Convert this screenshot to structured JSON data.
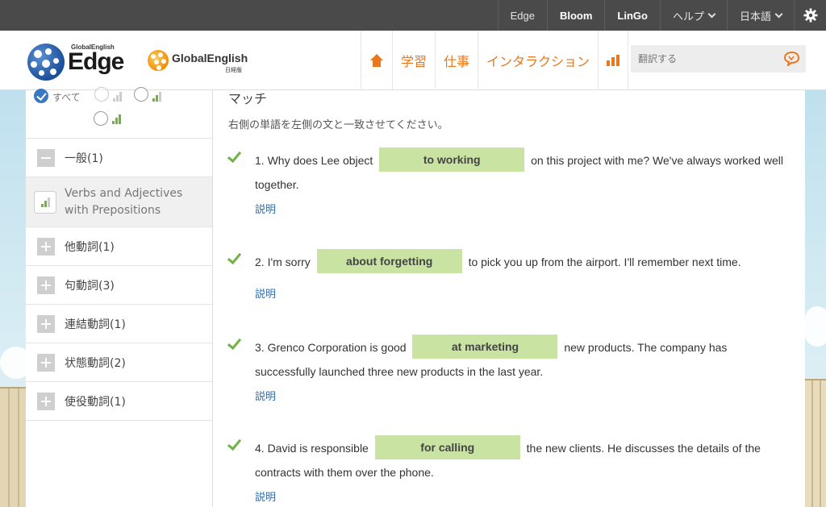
{
  "topbar": {
    "links": [
      "Edge",
      "Bloom",
      "LinGo"
    ],
    "help_label": "ヘルプ",
    "language_label": "日本語"
  },
  "header": {
    "logo_edge_small": "GlobalEnglish",
    "logo_edge_big": "Edge",
    "logo_ge_name": "GlobalEnglish",
    "logo_ge_sub": "日経版",
    "nav": [
      "学習",
      "仕事",
      "インタラクション"
    ],
    "search_placeholder": "翻訳する"
  },
  "sidebar": {
    "filter_all_label": "すべて",
    "items": [
      {
        "label": "一般(1)",
        "icon": "minus-box-icon"
      },
      {
        "label": "Verbs and Adjectives with Prepositions",
        "icon": "level-icon",
        "active": true
      },
      {
        "label": "他動詞(1)",
        "icon": "plus-box-icon"
      },
      {
        "label": "句動詞(3)",
        "icon": "plus-box-icon"
      },
      {
        "label": "連結動詞(1)",
        "icon": "plus-box-icon"
      },
      {
        "label": "状態動詞(2)",
        "icon": "plus-box-icon"
      },
      {
        "label": "使役動詞(1)",
        "icon": "plus-box-icon"
      }
    ]
  },
  "main": {
    "title": "マッチ",
    "instruction": "右側の単語を左側の文と一致させてください。",
    "explain_label": "説明",
    "questions": [
      {
        "before": "1. Why does Lee object",
        "answer": "to working",
        "after": "on this project with me? We've always worked well together."
      },
      {
        "before": "2. I'm sorry",
        "answer": "about forgetting",
        "after": "to pick you up from the airport. I'll remember next time."
      },
      {
        "before": "3. Grenco Corporation is good",
        "answer": "at marketing",
        "after": "new products. The company has successfully launched three new products in the last year."
      },
      {
        "before": "4. David is responsible",
        "answer": "for calling",
        "after": "the new clients. He discusses the details of the contracts with them over the phone."
      }
    ]
  },
  "colors": {
    "accent": "#e8771e",
    "answer_bg": "#c9e3a3",
    "check_green": "#6db33f",
    "link_blue": "#2f6fb0"
  }
}
